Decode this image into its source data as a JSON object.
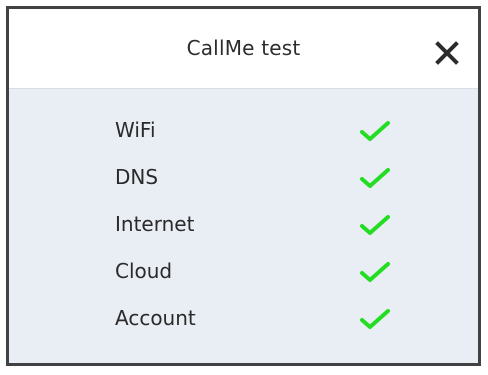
{
  "dialog": {
    "title": "CallMe test",
    "close_icon": "close-icon",
    "items": [
      {
        "label": "WiFi",
        "status_icon": "checkmark-icon",
        "status_color": "#22dd22"
      },
      {
        "label": "DNS",
        "status_icon": "checkmark-icon",
        "status_color": "#22dd22"
      },
      {
        "label": "Internet",
        "status_icon": "checkmark-icon",
        "status_color": "#22dd22"
      },
      {
        "label": "Cloud",
        "status_icon": "checkmark-icon",
        "status_color": "#22dd22"
      },
      {
        "label": "Account",
        "status_icon": "checkmark-icon",
        "status_color": "#22dd22"
      }
    ]
  }
}
